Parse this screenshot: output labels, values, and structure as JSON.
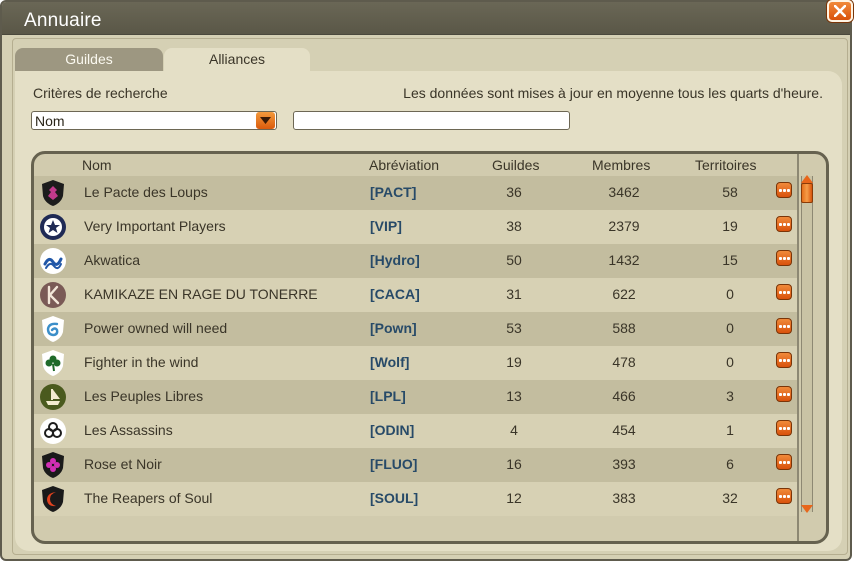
{
  "window": {
    "title": "Annuaire"
  },
  "tabs": [
    {
      "label": "Guildes",
      "active": false
    },
    {
      "label": "Alliances",
      "active": true
    }
  ],
  "search": {
    "criteria_label": "Critères de recherche",
    "criteria_selected": "Nom",
    "query_value": "",
    "update_info": "Les données sont mises à jour en moyenne tous les quarts d'heure."
  },
  "table": {
    "headers": {
      "name": "Nom",
      "abbreviation": "Abréviation",
      "guilds": "Guildes",
      "members": "Membres",
      "territories": "Territoires"
    },
    "rows": [
      {
        "emblem": "shield-wolf-emblem-icon",
        "name": "Le Pacte des Loups",
        "abbr": "[PACT]",
        "guilds": "36",
        "members": "3462",
        "territories": "58"
      },
      {
        "emblem": "star-badge-emblem-icon",
        "name": "Very Important Players",
        "abbr": "[VIP]",
        "guilds": "38",
        "members": "2379",
        "territories": "19"
      },
      {
        "emblem": "wave-emblem-icon",
        "name": "Akwatica",
        "abbr": "[Hydro]",
        "guilds": "50",
        "members": "1432",
        "territories": "15"
      },
      {
        "emblem": "letter-k-emblem-icon",
        "name": "KAMIKAZE EN RAGE DU TONERRE",
        "abbr": "[CACA]",
        "guilds": "31",
        "members": "622",
        "territories": "0"
      },
      {
        "emblem": "swirl-shield-emblem-icon",
        "name": "Power owned will need",
        "abbr": "[Pown]",
        "guilds": "53",
        "members": "588",
        "territories": "0"
      },
      {
        "emblem": "clover-emblem-icon",
        "name": "Fighter in the wind",
        "abbr": "[Wolf]",
        "guilds": "19",
        "members": "478",
        "territories": "0"
      },
      {
        "emblem": "ship-emblem-icon",
        "name": "Les Peuples Libres",
        "abbr": "[LPL]",
        "guilds": "13",
        "members": "466",
        "territories": "3"
      },
      {
        "emblem": "knot-emblem-icon",
        "name": "Les Assassins",
        "abbr": "[ODIN]",
        "guilds": "4",
        "members": "454",
        "territories": "1"
      },
      {
        "emblem": "flower-shield-emblem-icon",
        "name": "Rose et Noir",
        "abbr": "[FLUO]",
        "guilds": "16",
        "members": "393",
        "territories": "6"
      },
      {
        "emblem": "crescent-shield-emblem-icon",
        "name": "The Reapers of Soul",
        "abbr": "[SOUL]",
        "guilds": "12",
        "members": "383",
        "territories": "32"
      }
    ]
  },
  "colors": {
    "window_bg": "#d5d0b4",
    "titlebar": "#5e5b4d",
    "accent_orange": "#e8661a",
    "abbr_text": "#274a68",
    "row_dark": "#c3bd9f",
    "row_light": "#d7d1b4"
  }
}
